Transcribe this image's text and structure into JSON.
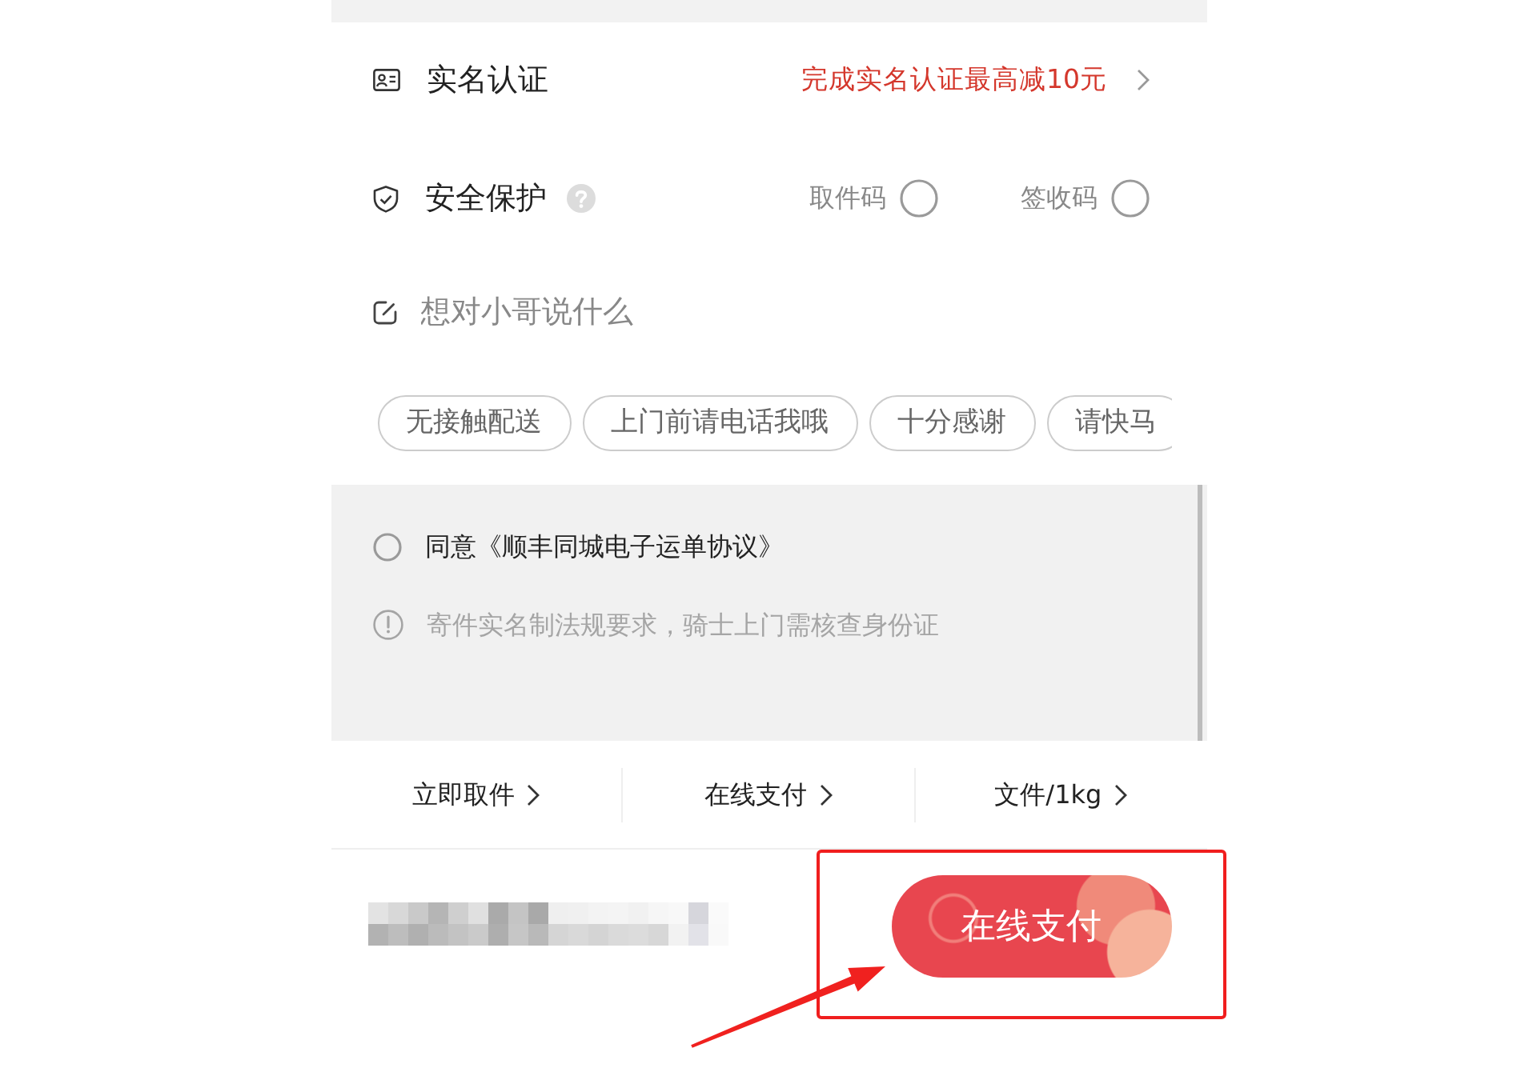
{
  "real_name": {
    "label": "实名认证",
    "promo": "完成实名认证最高减10元"
  },
  "security": {
    "label": "安全保护",
    "options": [
      {
        "label": "取件码",
        "checked": false
      },
      {
        "label": "签收码",
        "checked": false
      }
    ]
  },
  "message": {
    "placeholder": "想对小哥说什么"
  },
  "quick_replies": [
    "无接触配送",
    "上门前请电话我哦",
    "十分感谢",
    "请快马"
  ],
  "agreement": {
    "text": "同意《顺丰同城电子运单协议》",
    "checked": false
  },
  "notice": "寄件实名制法规要求，骑士上门需核查身份证",
  "order_options": [
    "立即取件",
    "在线支付",
    "文件/1kg"
  ],
  "pay_button": {
    "label": "在线支付"
  }
}
